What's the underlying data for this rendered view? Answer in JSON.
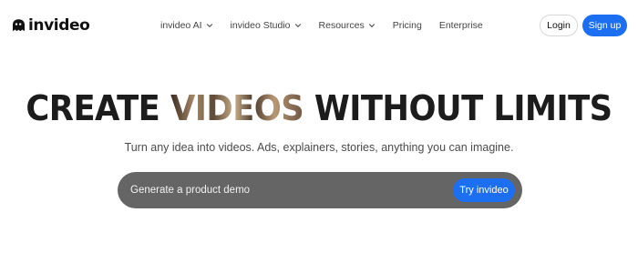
{
  "brand": {
    "name": "invideo",
    "logo_icon": "ghost-logo-icon"
  },
  "nav": {
    "items": [
      {
        "label": "invideo AI",
        "has_dropdown": true
      },
      {
        "label": "invideo Studio",
        "has_dropdown": true
      },
      {
        "label": "Resources",
        "has_dropdown": true
      },
      {
        "label": "Pricing",
        "has_dropdown": false
      },
      {
        "label": "Enterprise",
        "has_dropdown": false
      }
    ],
    "dropdown_icon": "chevron-down-icon"
  },
  "auth": {
    "login_label": "Login",
    "signup_label": "Sign up"
  },
  "hero": {
    "headline_part1": "CREATE",
    "headline_part2": "VIDEOS",
    "headline_part3": "WITHOUT LIMITS",
    "subtitle": "Turn any idea into videos. Ads, explainers, stories, anything you can imagine."
  },
  "prompt": {
    "placeholder": "Generate a product demo",
    "button_label": "Try invideo"
  },
  "colors": {
    "accent": "#1d6ff2",
    "prompt_bar": "#656565",
    "headline": "#1c1c1c"
  }
}
